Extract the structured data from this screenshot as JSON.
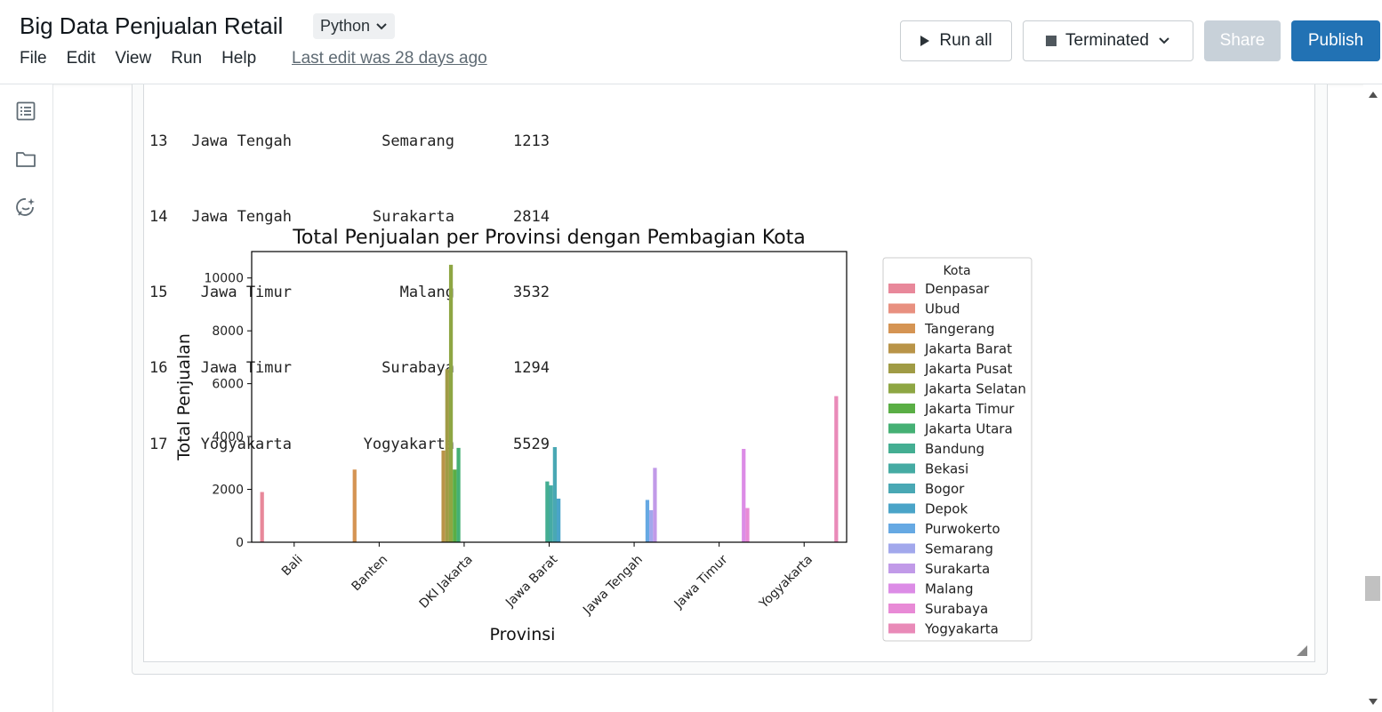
{
  "header": {
    "title": "Big Data Penjualan Retail",
    "language": "Python",
    "menu": [
      "File",
      "Edit",
      "View",
      "Run",
      "Help"
    ],
    "last_edit": "Last edit was 28 days ago",
    "run_all": "Run all",
    "status": "Terminated",
    "share": "Share",
    "publish": "Publish"
  },
  "icons": {
    "left_rail": [
      "table-of-contents-icon",
      "folder-icon",
      "assistant-icon"
    ],
    "run": "play-icon",
    "status": "stop-icon"
  },
  "colors": {
    "publish_bg": "#2272b4",
    "share_bg": "#c8d1d9"
  },
  "dataframe_rows": [
    {
      "idx": "13",
      "provinsi": "Jawa Tengah",
      "kota": "Semarang",
      "total": "1213"
    },
    {
      "idx": "14",
      "provinsi": "Jawa Tengah",
      "kota": "Surakarta",
      "total": "2814"
    },
    {
      "idx": "15",
      "provinsi": "Jawa Timur",
      "kota": "Malang",
      "total": "3532"
    },
    {
      "idx": "16",
      "provinsi": "Jawa Timur",
      "kota": "Surabaya",
      "total": "1294"
    },
    {
      "idx": "17",
      "provinsi": "Yogyakarta",
      "kota": "Yogyakarta",
      "total": "5529"
    }
  ],
  "chart_data": {
    "type": "bar",
    "title": "Total Penjualan per Provinsi dengan Pembagian Kota",
    "xlabel": "Provinsi",
    "ylabel": "Total Penjualan",
    "ylim": [
      0,
      11000
    ],
    "yticks": [
      0,
      2000,
      4000,
      6000,
      8000,
      10000
    ],
    "categories": [
      "Bali",
      "Banten",
      "DKI Jakarta",
      "Jawa Barat",
      "Jawa Tengah",
      "Jawa Timur",
      "Yogyakarta"
    ],
    "legend_title": "Kota",
    "legend_position": "outside-right",
    "grid": false,
    "series": [
      {
        "name": "Denpasar",
        "color": "#e8889a",
        "values": [
          1900,
          0,
          0,
          0,
          0,
          0,
          0
        ]
      },
      {
        "name": "Ubud",
        "color": "#e89080",
        "values": [
          0,
          0,
          0,
          0,
          0,
          0,
          0
        ]
      },
      {
        "name": "Tangerang",
        "color": "#d59453",
        "values": [
          0,
          2750,
          0,
          0,
          0,
          0,
          0
        ]
      },
      {
        "name": "Jakarta Barat",
        "color": "#b99448",
        "values": [
          0,
          0,
          3470,
          0,
          0,
          0,
          0
        ]
      },
      {
        "name": "Jakarta Pusat",
        "color": "#a09b45",
        "values": [
          0,
          0,
          6550,
          0,
          0,
          0,
          0
        ]
      },
      {
        "name": "Jakarta Selatan",
        "color": "#8ea643",
        "values": [
          0,
          0,
          10500,
          0,
          0,
          0,
          0
        ]
      },
      {
        "name": "Jakarta Timur",
        "color": "#5aae45",
        "values": [
          0,
          0,
          2750,
          0,
          0,
          0,
          0
        ]
      },
      {
        "name": "Jakarta Utara",
        "color": "#45b074",
        "values": [
          0,
          0,
          3570,
          0,
          0,
          0,
          0
        ]
      },
      {
        "name": "Bandung",
        "color": "#44ae92",
        "values": [
          0,
          0,
          0,
          2300,
          0,
          0,
          0
        ]
      },
      {
        "name": "Bekasi",
        "color": "#45aba3",
        "values": [
          0,
          0,
          0,
          2150,
          0,
          0,
          0
        ]
      },
      {
        "name": "Bogor",
        "color": "#49a8b4",
        "values": [
          0,
          0,
          0,
          3600,
          0,
          0,
          0
        ]
      },
      {
        "name": "Depok",
        "color": "#4aa4c8",
        "values": [
          0,
          0,
          0,
          1650,
          0,
          0,
          0
        ]
      },
      {
        "name": "Purwokerto",
        "color": "#66a9e3",
        "values": [
          0,
          0,
          0,
          0,
          1600,
          0,
          0
        ]
      },
      {
        "name": "Semarang",
        "color": "#a2a8ec",
        "values": [
          0,
          0,
          0,
          0,
          1213,
          0,
          0
        ]
      },
      {
        "name": "Surakarta",
        "color": "#c19ae8",
        "values": [
          0,
          0,
          0,
          0,
          2814,
          0,
          0
        ]
      },
      {
        "name": "Malang",
        "color": "#dc8ce6",
        "values": [
          0,
          0,
          0,
          0,
          0,
          3532,
          0
        ]
      },
      {
        "name": "Surabaya",
        "color": "#e88ad6",
        "values": [
          0,
          0,
          0,
          0,
          0,
          1294,
          0
        ]
      },
      {
        "name": "Yogyakarta",
        "color": "#e98ab8",
        "values": [
          0,
          0,
          0,
          0,
          0,
          0,
          5529
        ]
      }
    ]
  }
}
